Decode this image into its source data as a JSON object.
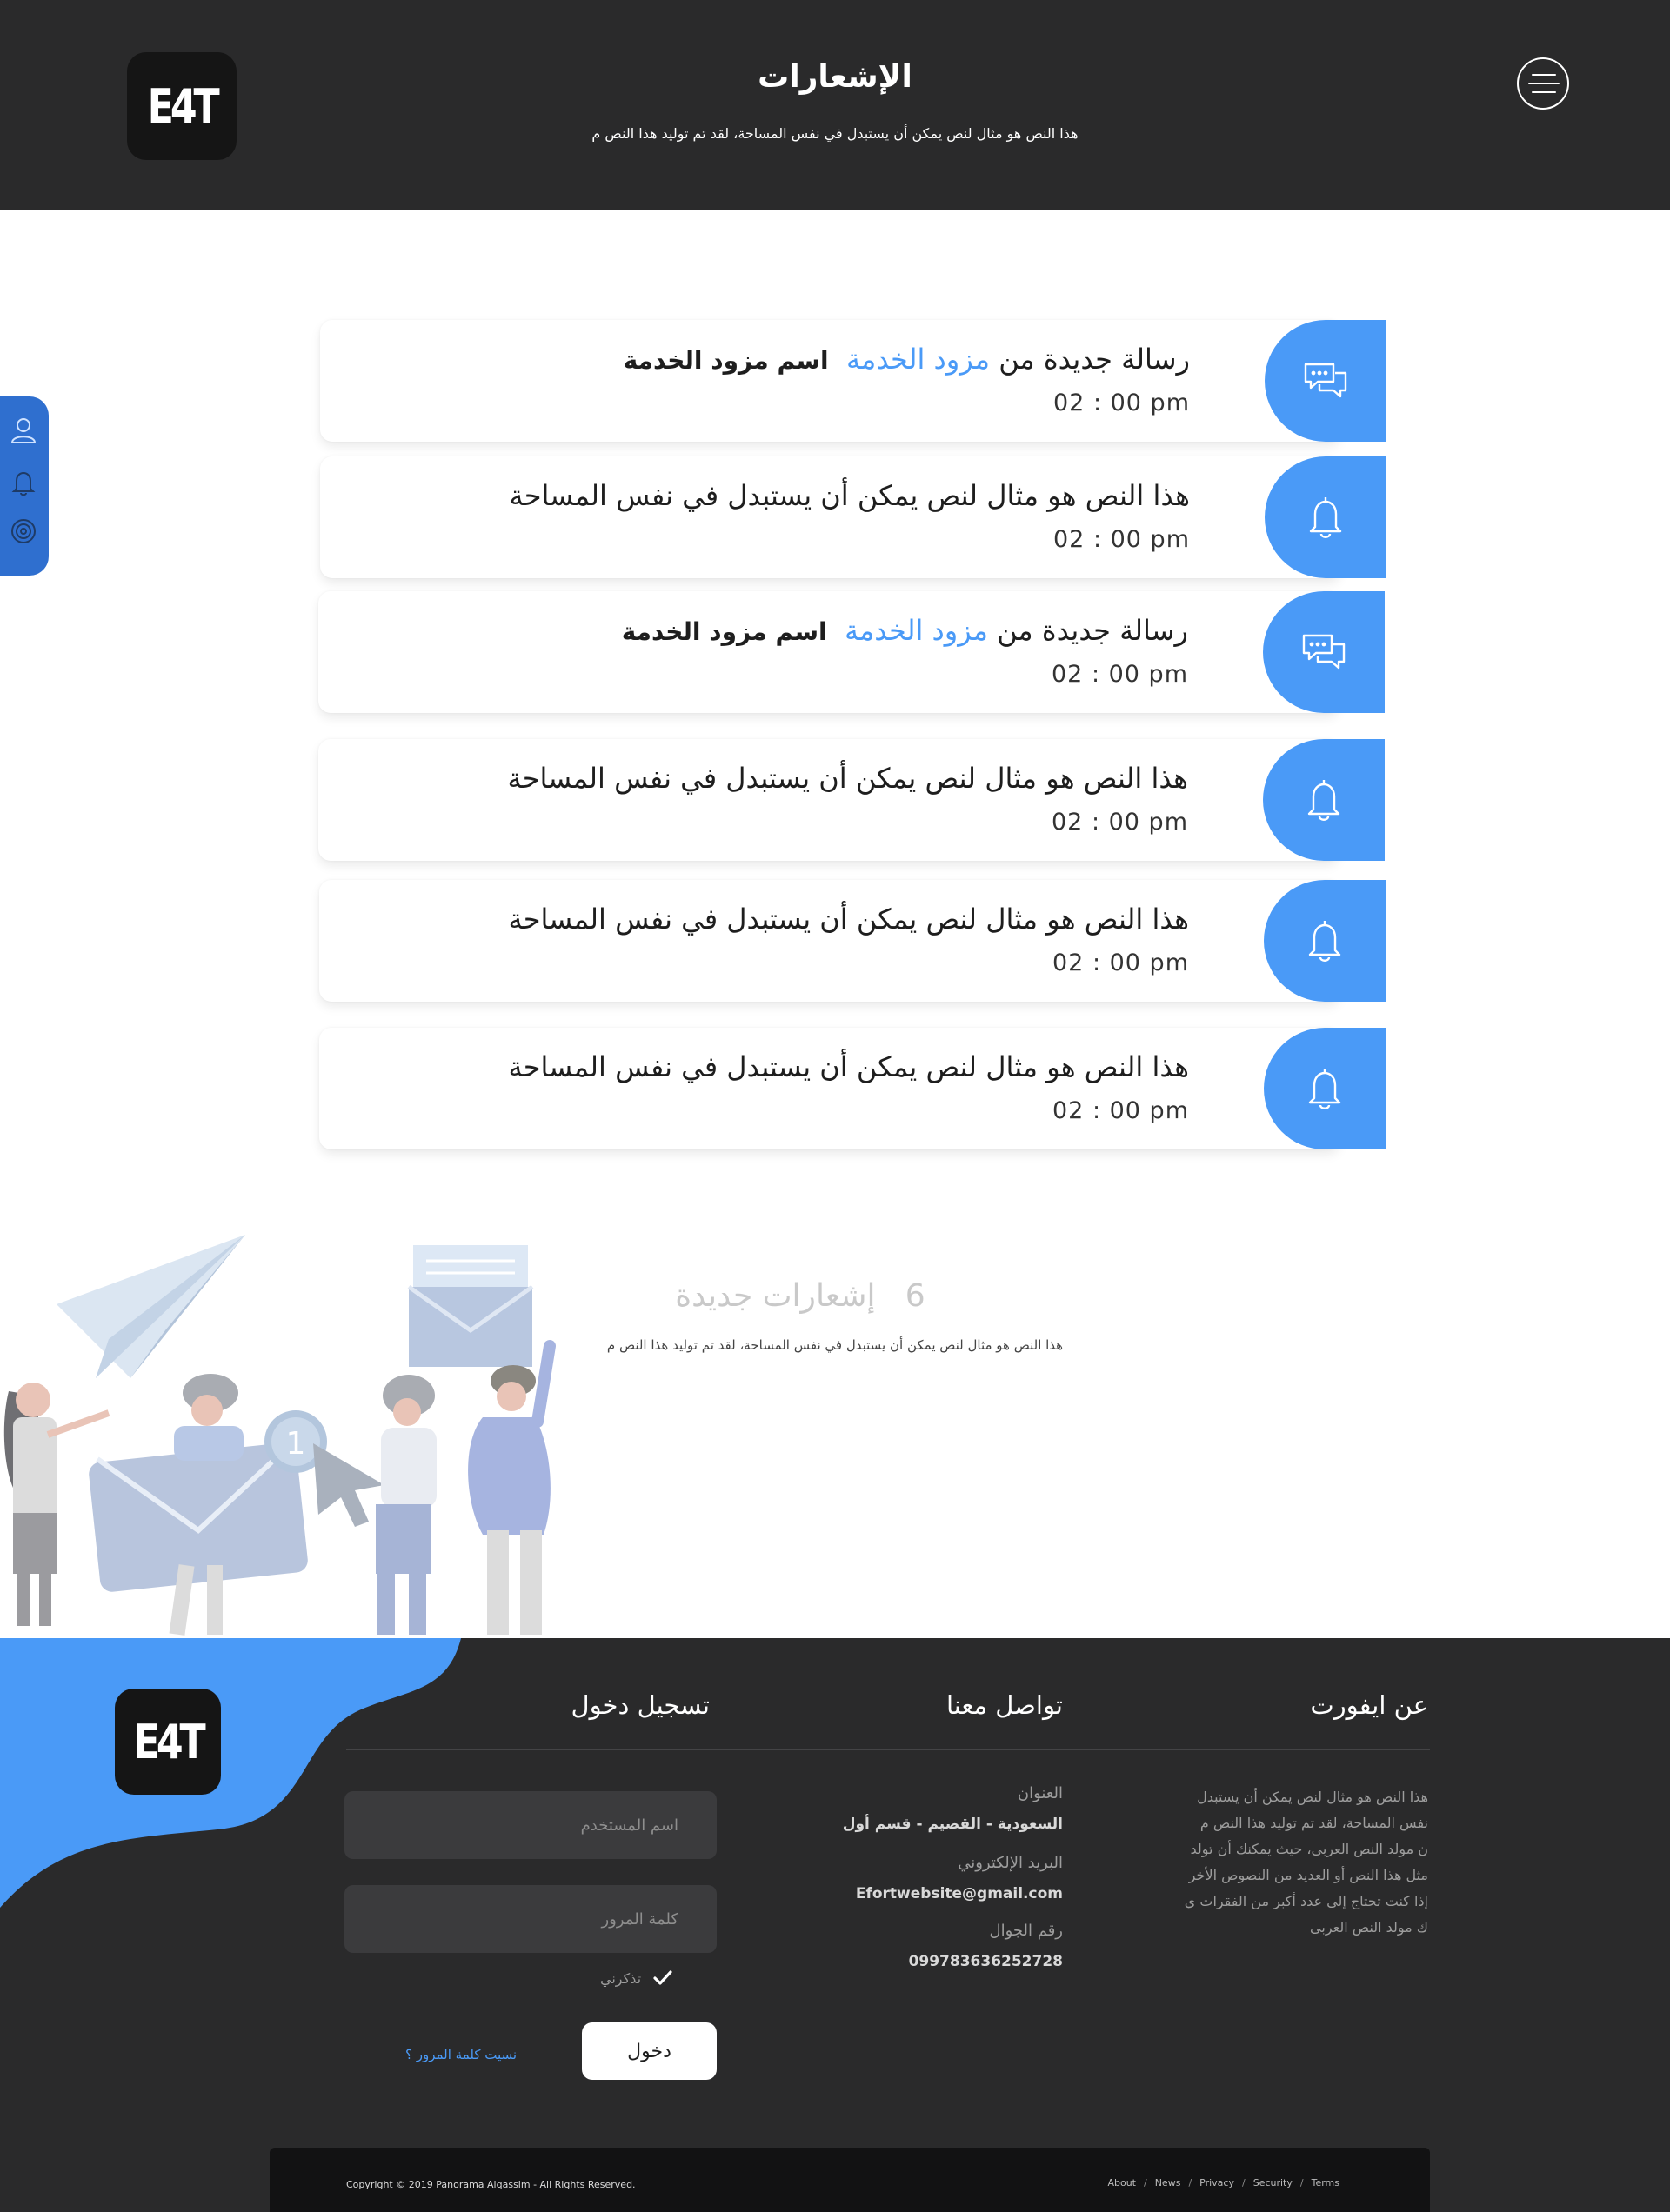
{
  "brand": {
    "logo_text": "E4T"
  },
  "header": {
    "title": "الإشعارات",
    "subtitle": "هذا النص هو مثال لنص يمكن أن يستبدل في نفس المساحة، لقد تم توليد هذا النص م"
  },
  "colors": {
    "accent": "#4a9af7",
    "dark": "#2a2a2b",
    "side_tab": "#2f6fcf"
  },
  "side_tab": {
    "icons": [
      "user-icon",
      "bell-icon",
      "settings-icon"
    ]
  },
  "notifications": [
    {
      "type": "message",
      "icon": "chat-icon",
      "prefix": "رسالة جديدة من",
      "provider_link": "مزود الخدمة",
      "provider_name": "اسم مزود الخدمة",
      "time": "02 : 00 pm"
    },
    {
      "type": "alert",
      "icon": "bell-icon",
      "text": "هذا النص هو مثال لنص يمكن أن يستبدل في نفس المساحة",
      "time": "02 : 00 pm"
    },
    {
      "type": "message",
      "icon": "chat-icon",
      "prefix": "رسالة جديدة من",
      "provider_link": "مزود الخدمة",
      "provider_name": "اسم مزود الخدمة",
      "time": "02 : 00 pm"
    },
    {
      "type": "alert",
      "icon": "bell-icon",
      "text": "هذا النص هو مثال لنص يمكن أن يستبدل في نفس المساحة",
      "time": "02 : 00 pm"
    },
    {
      "type": "alert",
      "icon": "bell-icon",
      "text": "هذا النص هو مثال لنص يمكن أن يستبدل في نفس المساحة",
      "time": "02 : 00 pm"
    },
    {
      "type": "alert",
      "icon": "bell-icon",
      "text": "هذا النص هو مثال لنص يمكن أن يستبدل في نفس المساحة",
      "time": "02 : 00 pm"
    }
  ],
  "summary": {
    "count": "6",
    "label": "إشعارات جديدة",
    "subtitle": "هذا النص هو مثال لنص يمكن أن يستبدل في نفس المساحة، لقد تم توليد هذا النص م",
    "illustration_badge": "1"
  },
  "footer": {
    "about": {
      "heading": "عن ايفورت",
      "lines": [
        "هذا النص هو مثال لنص يمكن أن يستبدل",
        "نفس المساحة، لقد تم توليد هذا النص م",
        "ن مولد النص العربى، حيث يمكنك أن تولد",
        "مثل هذا النص أو العديد من النصوص الأخر",
        "إذا كنت تحتاج إلى عدد أكبر من الفقرات ي",
        "ك مولد النص العربى"
      ]
    },
    "contact": {
      "heading": "تواصل معنا",
      "address_label": "العنوان",
      "address_value": "السعودية - القصيم - قسم أول",
      "email_label": "البريد الإلكتروني",
      "email_value": "Efortwebsite@gmail.com",
      "phone_label": "رقم الجوال",
      "phone_value": "099783636252728"
    },
    "login": {
      "heading": "تسجيل دخول",
      "username_placeholder": "اسم المستخدم",
      "password_placeholder": "كلمة المرور",
      "remember_label": "تذكرني",
      "submit_label": "دخول",
      "forgot_label": "نسيت كلمة المرور ؟"
    },
    "copyright": "Copyright © 2019  Panorama Alqassim -  All Rights Reserved.",
    "links": [
      "About",
      "News",
      "Privacy",
      "Security",
      "Terms"
    ]
  }
}
